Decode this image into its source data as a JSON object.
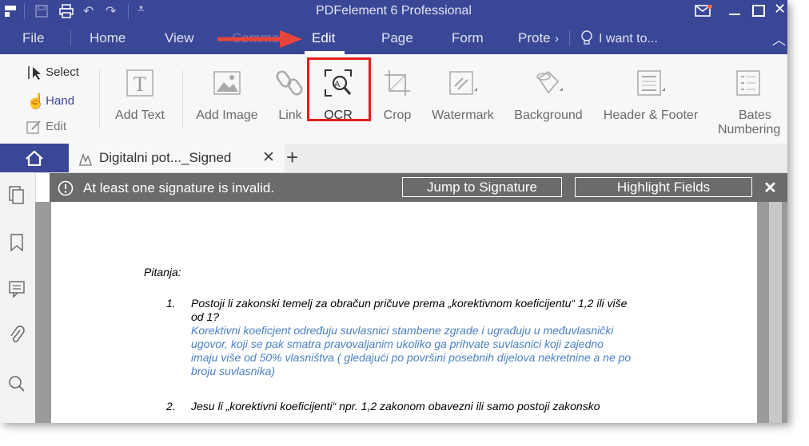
{
  "app": {
    "title": "PDFelement 6 Professional"
  },
  "menu": {
    "items": [
      "File",
      "Home",
      "View",
      "Comment",
      "Edit",
      "Page",
      "Form",
      "Prote"
    ],
    "search_placeholder": "I want to..."
  },
  "ribbon": {
    "side_tools": {
      "select": "Select",
      "hand": "Hand",
      "edit": "Edit"
    },
    "tools": {
      "add_text": "Add Text",
      "add_image": "Add Image",
      "link": "Link",
      "ocr": "OCR",
      "crop": "Crop",
      "watermark": "Watermark",
      "background": "Background",
      "header_footer": "Header & Footer",
      "bates_1": "Bates",
      "bates_2": "Numbering"
    }
  },
  "tabs": {
    "document": "Digitalni pot..._Signed"
  },
  "notification": {
    "message": "At least one signature is invalid.",
    "jump": "Jump to Signature",
    "highlight": "Highlight Fields"
  },
  "document": {
    "heading": "Pitanja:",
    "q1_num": "1.",
    "q1_line1": "Postoji li zakonski temelj za obračun pričuve prema „korektivnom koeficijentu“ 1,2 ili više",
    "q1_line2": "od 1?",
    "a1_line1": "Korektivni koeficjent određuju suvlasnici stambene zgrade i ugrađuju u međuvlasnički",
    "a1_line2": "ugovor, koji se pak smatra pravovaljanim ukoliko ga prihvate suvlasnici koji zajedno",
    "a1_line3": "imaju više od 50% vlasništva ( gledajući po površini posebnih dijelova nekretnine a ne po",
    "a1_line4": "broju suvlasnika)",
    "q2_num": "2.",
    "q2_line1": "Jesu li „korektivni koeficijenti“ npr. 1,2 zakonom obavezni ili samo postoji zakonsko"
  },
  "colors": {
    "brand": "#3a4796",
    "highlight_box": "#e0201f",
    "answer_text": "#4a7fc4"
  }
}
